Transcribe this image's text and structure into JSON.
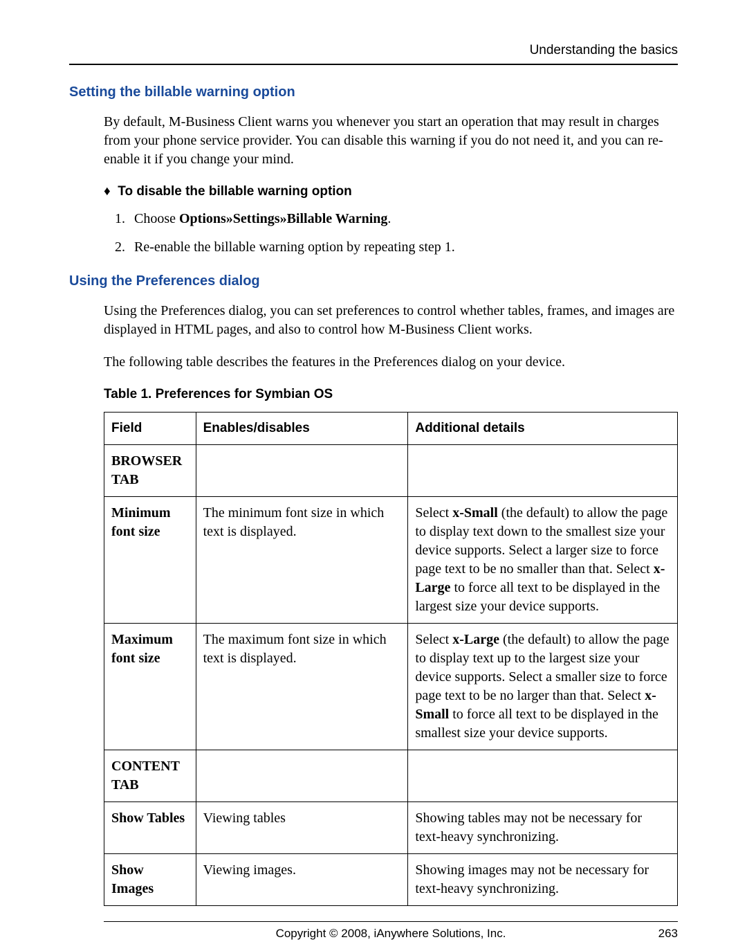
{
  "running_header": "Understanding the basics",
  "section1": {
    "title": "Setting the billable warning option",
    "intro": "By default, M-Business Client warns you whenever you start an operation that may result in charges from your phone service provider. You can disable this warning if you do not need it, and you can re-enable it if you change your mind.",
    "proc_title": "To disable the billable warning option",
    "steps": {
      "s1_pre": "Choose ",
      "s1_bold": "Options»Settings»Billable Warning",
      "s1_post": ".",
      "s2": "Re-enable the billable warning option by repeating step 1."
    }
  },
  "section2": {
    "title": "Using the Preferences dialog",
    "p1": "Using the Preferences dialog, you can set preferences to control whether tables, frames, and images are displayed in HTML pages, and also to control how M-Business Client works.",
    "p2": "The following table describes the features in the Preferences dialog on your device.",
    "table_caption": "Table 1. Preferences for Symbian OS",
    "headers": {
      "c1": "Field",
      "c2": "Enables/disables",
      "c3": "Additional details"
    },
    "rows": [
      {
        "field": "BROWSER TAB",
        "enables": "",
        "details": ""
      },
      {
        "field": "Minimum font size",
        "enables": "The minimum font size in which text is displayed.",
        "details_pre": "Select ",
        "details_b1": "x-Small",
        "details_mid1": " (the default) to allow the page to display text down to the smallest size your device supports. Select a larger size to force page text to be no smaller than that. Select ",
        "details_b2": "x-Large",
        "details_post": " to force all text to be displayed in the largest size your device supports."
      },
      {
        "field": "Maximum font size",
        "enables": "The maximum font size in which text is displayed.",
        "details_pre": "Select ",
        "details_b1": "x-Large",
        "details_mid1": " (the default) to allow the page to display text up to the largest size your device supports. Select a smaller size to force page text to be no larger than that. Select ",
        "details_b2": "x-Small",
        "details_post": " to force all text to be displayed in the smallest size your device supports."
      },
      {
        "field": "CONTENT TAB",
        "enables": "",
        "details": ""
      },
      {
        "field": "Show Tables",
        "enables": "Viewing tables",
        "details": "Showing tables may not be necessary for text-heavy synchronizing."
      },
      {
        "field": "Show Images",
        "enables": "Viewing images.",
        "details": "Showing images may not be necessary for text-heavy synchronizing."
      }
    ]
  },
  "footer": {
    "copyright": "Copyright © 2008, iAnywhere Solutions, Inc.",
    "page": "263"
  }
}
